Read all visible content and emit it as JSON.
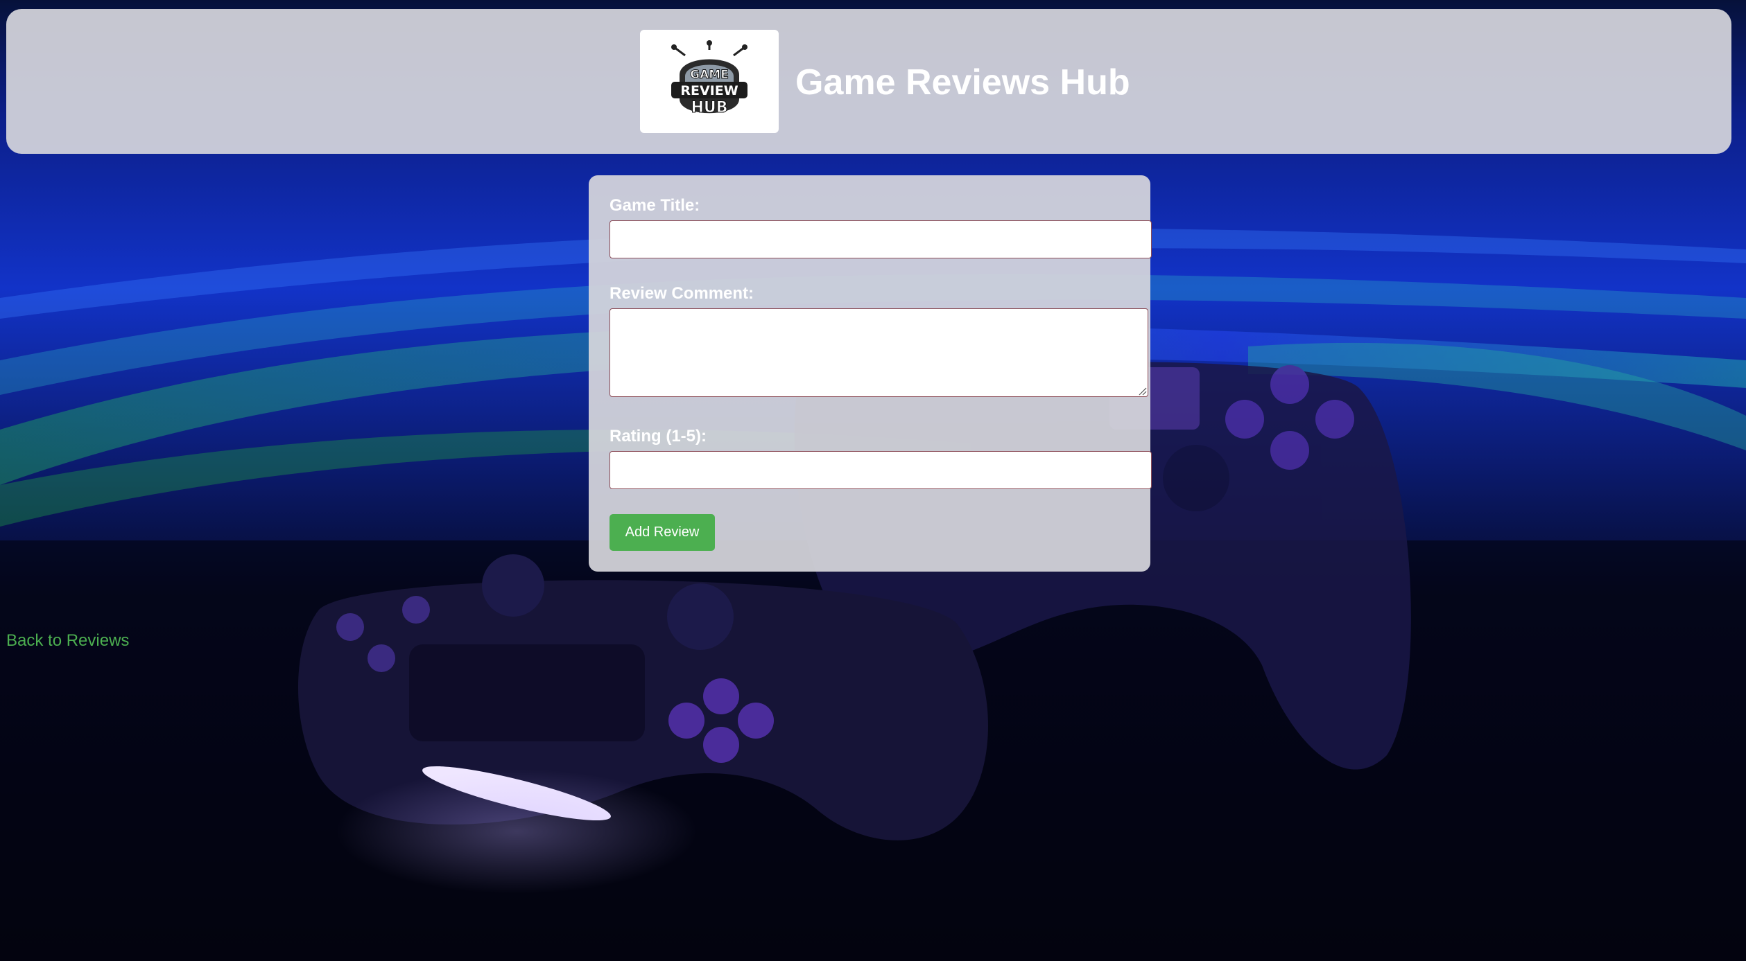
{
  "header": {
    "logo_text": [
      "GAME",
      "REVIEW",
      "HUB"
    ],
    "title": "Game Reviews Hub"
  },
  "form": {
    "game_title_label": "Game Title:",
    "game_title_value": "",
    "review_comment_label": "Review Comment:",
    "review_comment_value": "",
    "rating_label": "Rating (1-5):",
    "rating_value": "",
    "submit_label": "Add Review"
  },
  "nav": {
    "back_link": "Back to Reviews"
  },
  "colors": {
    "accent_green": "#4caf50",
    "panel": "#d6d6dc",
    "input_border": "#8a4a55"
  }
}
